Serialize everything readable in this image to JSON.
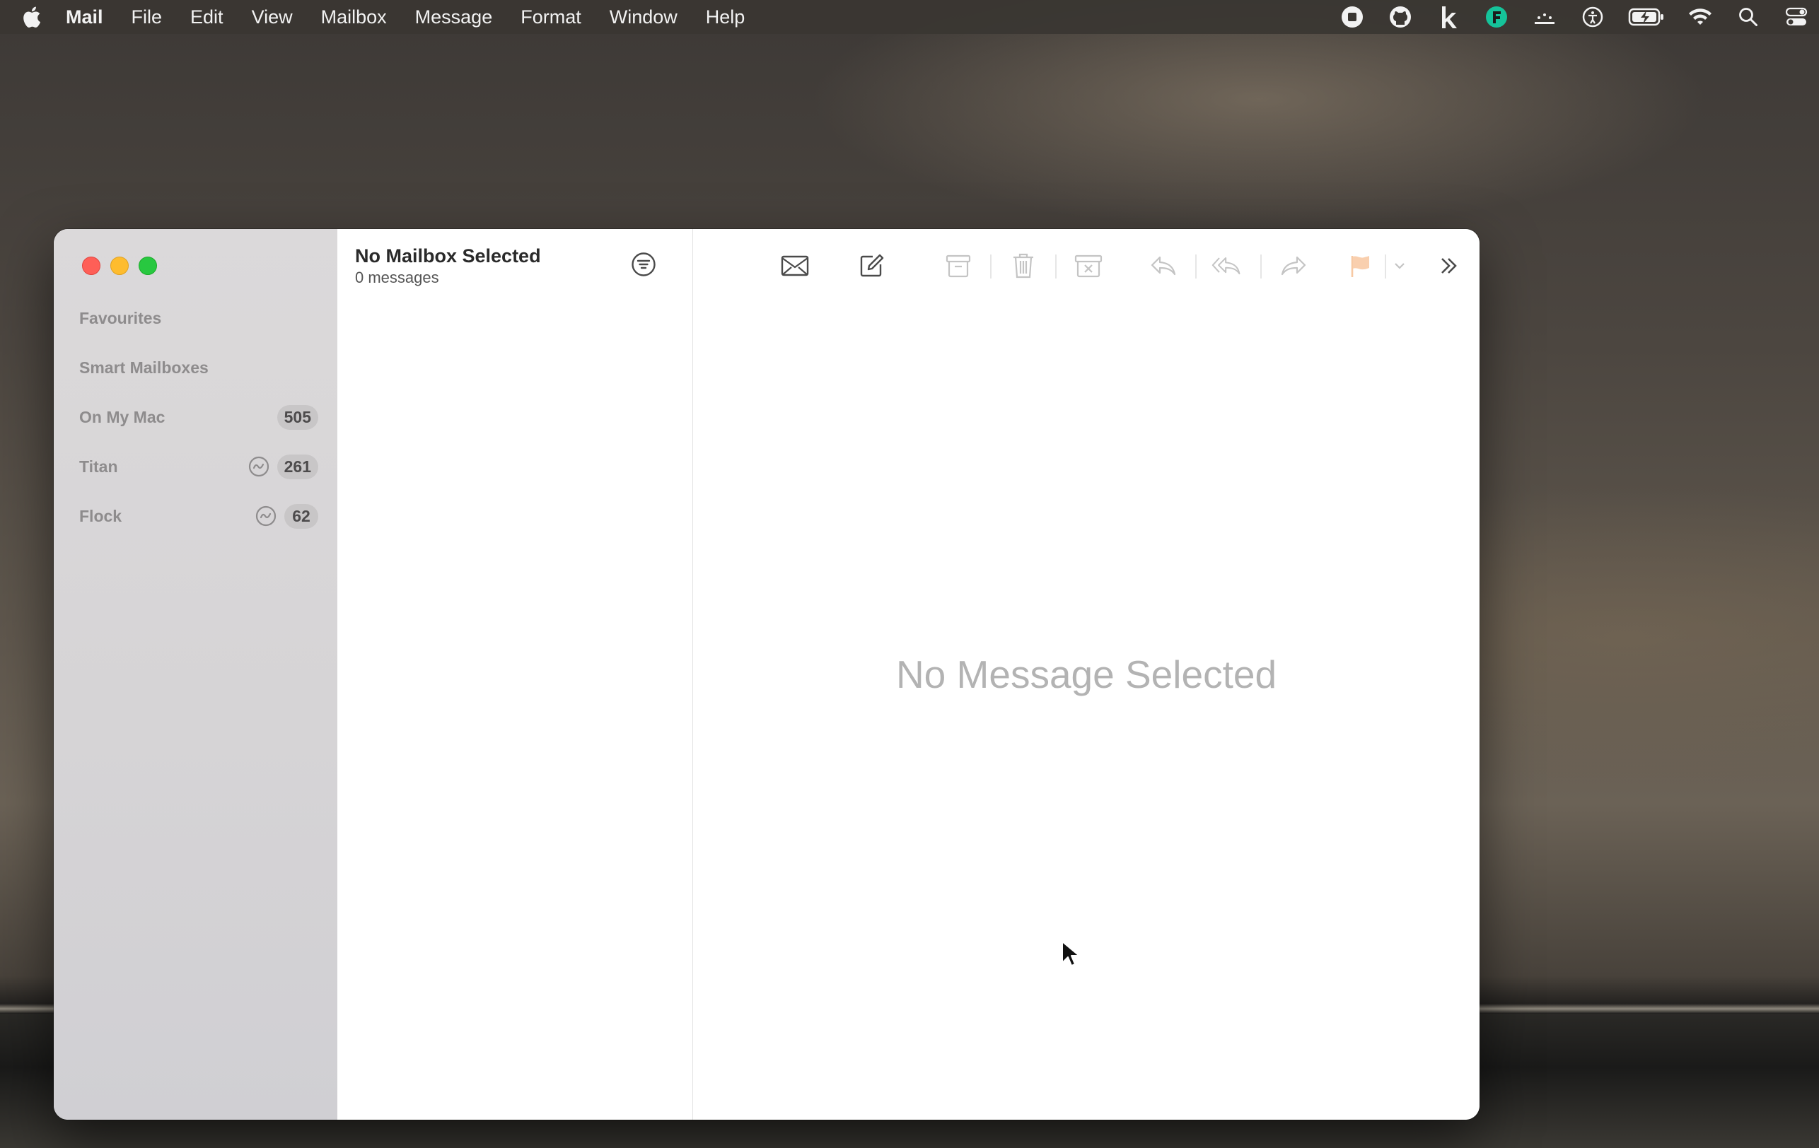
{
  "menubar": {
    "app_name": "Mail",
    "items": [
      "File",
      "Edit",
      "View",
      "Mailbox",
      "Message",
      "Format",
      "Window",
      "Help"
    ],
    "status_icons": [
      "record-icon",
      "github-icon",
      "k-app-icon",
      "grammarly-icon",
      "display-icon",
      "accessibility-icon",
      "battery-charging-icon",
      "wifi-icon",
      "spotlight-icon",
      "control-center-icon"
    ]
  },
  "sidebar": {
    "sections": [
      {
        "label": "Favourites"
      },
      {
        "label": "Smart Mailboxes"
      },
      {
        "label": "On My Mac",
        "count": "505"
      },
      {
        "label": "Titan",
        "count": "261",
        "activity": true
      },
      {
        "label": "Flock",
        "count": "62",
        "activity": true
      }
    ]
  },
  "message_list": {
    "title": "No Mailbox Selected",
    "subtitle": "0 messages"
  },
  "toolbar": {
    "buttons": [
      "get-mail",
      "compose",
      "archive",
      "delete",
      "junk",
      "reply",
      "reply-all",
      "forward",
      "flag",
      "flag-menu",
      "more",
      "search"
    ],
    "flag_color": "#f5a623"
  },
  "viewer": {
    "empty_text": "No Message Selected"
  }
}
